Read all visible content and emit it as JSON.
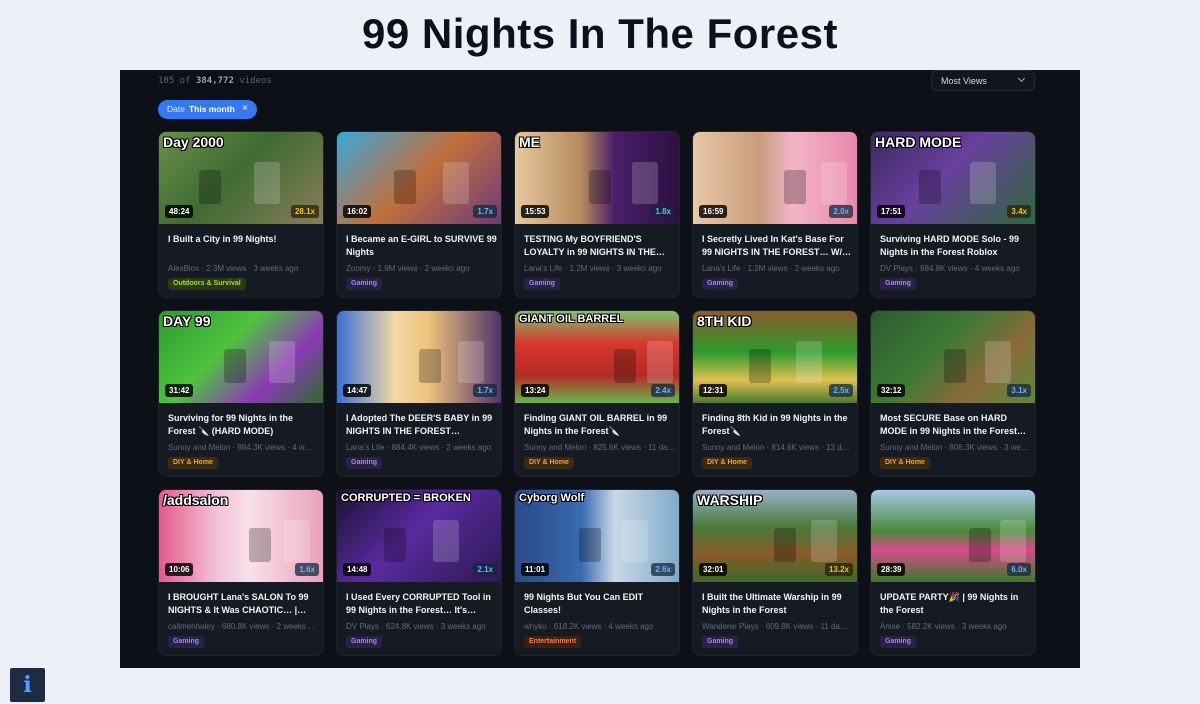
{
  "page": {
    "title": "99 Nights In The Forest"
  },
  "results": {
    "count_prefix": "105 of",
    "total": "384,772",
    "count_suffix": "videos"
  },
  "sort": {
    "selected": "Most Views"
  },
  "filter_chip": {
    "label": "Date",
    "value": "This month",
    "remove_glyph": "×"
  },
  "info_button": {
    "glyph": "i"
  },
  "videos": [
    {
      "overlay": "Day 2000",
      "duration": "48:24",
      "multiplier": "28.1x",
      "mult_color": "yellow",
      "title": "I Built a City in 99 Nights!",
      "channel": "AlexBlox",
      "views": "2.3M views",
      "age": "3 weeks ago",
      "category": "Outdoors & Survival",
      "tag": "outdoors",
      "bg": "linear-gradient(135deg,#6a8f4d,#3f6b32 45%,#8a7c5b)"
    },
    {
      "overlay": "",
      "duration": "16:02",
      "multiplier": "1.7x",
      "mult_color": "blue",
      "title": "I Became an E-GIRL to SURVIVE 99 Nights",
      "channel": "Zoomy",
      "views": "1.9M views",
      "age": "2 weeks ago",
      "category": "Gaming",
      "tag": "gaming",
      "bg": "linear-gradient(135deg,#3ba7d9,#c16f3c 50%,#6b3a7a)"
    },
    {
      "overlay": "ME",
      "duration": "15:53",
      "multiplier": "1.8x",
      "mult_color": "blue",
      "title": "TESTING My BOYFRIEND'S LOYALTY in 99 NIGHTS IN THE…",
      "channel": "Lana's Life",
      "views": "1.2M views",
      "age": "3 weeks ago",
      "category": "Gaming",
      "tag": "gaming",
      "bg": "linear-gradient(90deg,#e7c8a0,#b58a5d 40%,#4b1f6b 60%,#2c1040)"
    },
    {
      "overlay": "",
      "duration": "16:59",
      "multiplier": "2.0x",
      "mult_color": "blue",
      "title": "I Secretly Lived In Kat's Base For 99 NIGHTS IN THE FOREST… W/…",
      "channel": "Lana's Life",
      "views": "1.2M views",
      "age": "2 weeks ago",
      "category": "Gaming",
      "tag": "gaming",
      "bg": "linear-gradient(90deg,#e9c7a8,#c79c7c 40%,#f3b4c9 60%,#e886a9)"
    },
    {
      "overlay": "HARD MODE",
      "duration": "17:51",
      "multiplier": "3.4x",
      "mult_color": "yellow",
      "title": "Surviving HARD MODE Solo - 99 Nights in the Forest Roblox",
      "channel": "DV Plays",
      "views": "984.8K views",
      "age": "4 weeks ago",
      "category": "Gaming",
      "tag": "gaming",
      "bg": "linear-gradient(135deg,#3a2a5e,#6a3f9e 45%,#2d6a3a)"
    },
    {
      "overlay": "DAY 99",
      "duration": "31:42",
      "multiplier": "",
      "mult_color": "blue",
      "title": "Surviving for 99 Nights in the Forest 🔪 (HARD MODE)",
      "channel": "Sunny and Melon",
      "views": "984.3K views",
      "age": "4 w…",
      "category": "DIY & Home",
      "tag": "diy",
      "bg": "linear-gradient(135deg,#2d9b2d,#4fc33f 40%,#8a3bb5 70%,#2c6a2c)"
    },
    {
      "overlay": "",
      "duration": "14:47",
      "multiplier": "1.7x",
      "mult_color": "blue",
      "title": "I Adopted The DEER'S BABY in 99 NIGHTS IN THE FOREST…",
      "channel": "Lana's Life",
      "views": "884.4K views",
      "age": "2 weeks ago",
      "category": "Gaming",
      "tag": "gaming",
      "bg": "linear-gradient(90deg,#3d6fd6,#f1d9a4 35%,#f0c17a 55%,#4b2f6b)"
    },
    {
      "overlay": "GIANT OIL BARREL",
      "duration": "13:24",
      "multiplier": "2.4x",
      "mult_color": "blue",
      "title": "Finding GIANT OIL BARREL in 99 Nights in the Forest🔪",
      "channel": "Sunny and Melon",
      "views": "825.6K views",
      "age": "11 da…",
      "category": "DIY & Home",
      "tag": "diy",
      "bg": "linear-gradient(180deg,#7bc46a,#d8382f 35%,#b52a25 70%,#6ab54e)"
    },
    {
      "overlay": "8TH KID",
      "duration": "12:31",
      "multiplier": "2.5x",
      "mult_color": "blue",
      "title": "Finding 8th Kid in 99 Nights in the Forest🔪",
      "channel": "Sunny and Melon",
      "views": "814.6K views",
      "age": "13 da…",
      "category": "DIY & Home",
      "tag": "diy",
      "bg": "linear-gradient(180deg,#8b5a2b,#2d9b2d 45%,#e0c050 75%,#4a7a2e)"
    },
    {
      "overlay": "",
      "duration": "32:12",
      "multiplier": "3.1x",
      "mult_color": "blue",
      "title": "Most SECURE Base on HARD MODE in 99 Nights in the Forest…",
      "channel": "Sunny and Melon",
      "views": "806.3K views",
      "age": "3 we…",
      "category": "DIY & Home",
      "tag": "diy",
      "bg": "linear-gradient(135deg,#2d5a2d,#3d7a35 40%,#8a6a3a 70%,#5a8a3a)"
    },
    {
      "overlay": "/addsalon",
      "duration": "10:06",
      "multiplier": "1.6x",
      "mult_color": "blue",
      "title": "I BROUGHT Lana's SALON To 99 NIGHTS & It Was CHAOTIC… |…",
      "channel": "callmehhaley",
      "views": "680.8K views",
      "age": "2 weeks …",
      "category": "Gaming",
      "tag": "gaming",
      "bg": "linear-gradient(90deg,#e45a8a,#f3c3d8 35%,#f8e0e8 55%,#e8a0b8)"
    },
    {
      "overlay": "CORRUPTED = BROKEN",
      "duration": "14:48",
      "multiplier": "2.1x",
      "mult_color": "blue",
      "title": "I Used Every CORRUPTED Tool in 99 Nights in the Forest… It's…",
      "channel": "DV Plays",
      "views": "624.8K views",
      "age": "3 weeks ago",
      "category": "Gaming",
      "tag": "gaming",
      "bg": "linear-gradient(135deg,#1a1230,#5a2aa0 45%,#2a1a50)"
    },
    {
      "overlay": "Cyborg Wolf",
      "duration": "11:01",
      "multiplier": "2.6x",
      "mult_color": "blue",
      "title": "99 Nights But You Can EDIT Classes!",
      "channel": "whyku",
      "views": "618.2K views",
      "age": "4 weeks ago",
      "category": "Entertainment",
      "tag": "ent",
      "bg": "linear-gradient(90deg,#2a4a8a,#3a6ab0 40%,#c8d8e8 60%,#7fa8c8)"
    },
    {
      "overlay": "WARSHIP",
      "duration": "32:01",
      "multiplier": "13.2x",
      "mult_color": "yellow",
      "title": "I Built the Ultimate Warship in 99 Nights in the Forest",
      "channel": "Wanderer Plays",
      "views": "609.8K views",
      "age": "11 da…",
      "category": "Gaming",
      "tag": "gaming",
      "bg": "linear-gradient(180deg,#9ab0c8,#4a7a3a 40%,#8a5a2a 70%,#3a6a2a)"
    },
    {
      "overlay": "",
      "duration": "28:39",
      "multiplier": "6.0x",
      "mult_color": "blue",
      "title": "UPDATE PARTY🎉 | 99 Nights in the Forest",
      "channel": "Anise",
      "views": "582.2K views",
      "age": "3 weeks ago",
      "category": "Gaming",
      "tag": "gaming",
      "bg": "linear-gradient(180deg,#a8c8e8,#4a8a3a 45%,#d84a8a 65%,#3a7a2a)"
    }
  ]
}
